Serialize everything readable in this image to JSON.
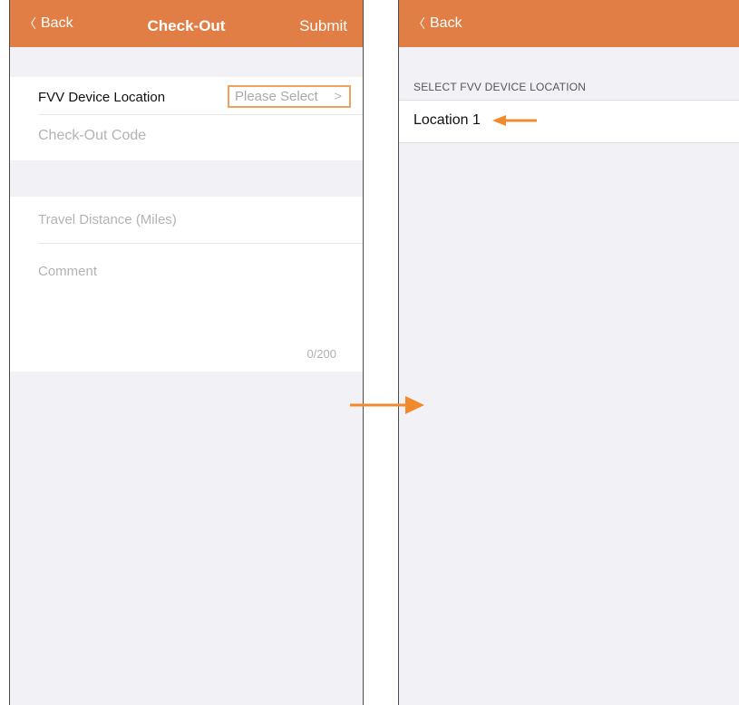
{
  "colors": {
    "accent": "#e07e45",
    "callout": "#ef8b2c",
    "background": "#f2f2f6"
  },
  "checkout_screen": {
    "nav": {
      "back_icon": "chevron-left",
      "back_label": "Back",
      "title": "Check-Out",
      "submit_label": "Submit"
    },
    "fvv_location": {
      "label": "FVV Device Location",
      "picker_value": "Please Select",
      "picker_icon": "chevron-right"
    },
    "checkout_code_placeholder": "Check-Out Code",
    "travel_distance_placeholder": "Travel Distance (Miles)",
    "comment_placeholder": "Comment",
    "comment_counter": "0/200"
  },
  "location_screen": {
    "nav": {
      "back_icon": "chevron-left",
      "back_label": "Back"
    },
    "section_header": "SELECT FVV DEVICE LOCATION",
    "items": [
      {
        "label": "Location 1"
      }
    ]
  }
}
